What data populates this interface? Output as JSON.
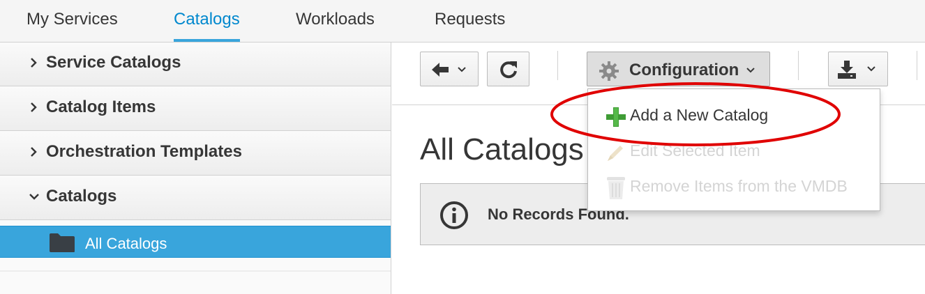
{
  "topnav": {
    "tabs": [
      {
        "label": "My Services"
      },
      {
        "label": "Catalogs",
        "active": true
      },
      {
        "label": "Workloads"
      },
      {
        "label": "Requests"
      }
    ]
  },
  "sidebar": {
    "sections": [
      {
        "label": "Service Catalogs",
        "expanded": false
      },
      {
        "label": "Catalog Items",
        "expanded": false
      },
      {
        "label": "Orchestration Templates",
        "expanded": false
      },
      {
        "label": "Catalogs",
        "expanded": true
      }
    ],
    "tree": {
      "selected_label": "All Catalogs",
      "icon": "folder-icon"
    }
  },
  "toolbar": {
    "back_icon": "arrow-left-icon",
    "refresh_icon": "refresh-icon",
    "configuration_label": "Configuration",
    "configuration_icon": "gear-icon",
    "download_icon": "download-icon"
  },
  "configuration_menu": {
    "items": [
      {
        "label": "Add a New Catalog",
        "icon": "plus-icon",
        "enabled": true
      },
      {
        "label": "Edit Selected Item",
        "icon": "pencil-icon",
        "enabled": false
      },
      {
        "label": "Remove Items from the VMDB",
        "icon": "trash-icon",
        "enabled": false
      }
    ]
  },
  "main": {
    "title": "All Catalogs",
    "alert_text": "No Records Found."
  },
  "colors": {
    "accent": "#0088ce",
    "selected_row": "#39a5dc",
    "annotation": "#e00000",
    "plus_green": "#3f9c35"
  }
}
